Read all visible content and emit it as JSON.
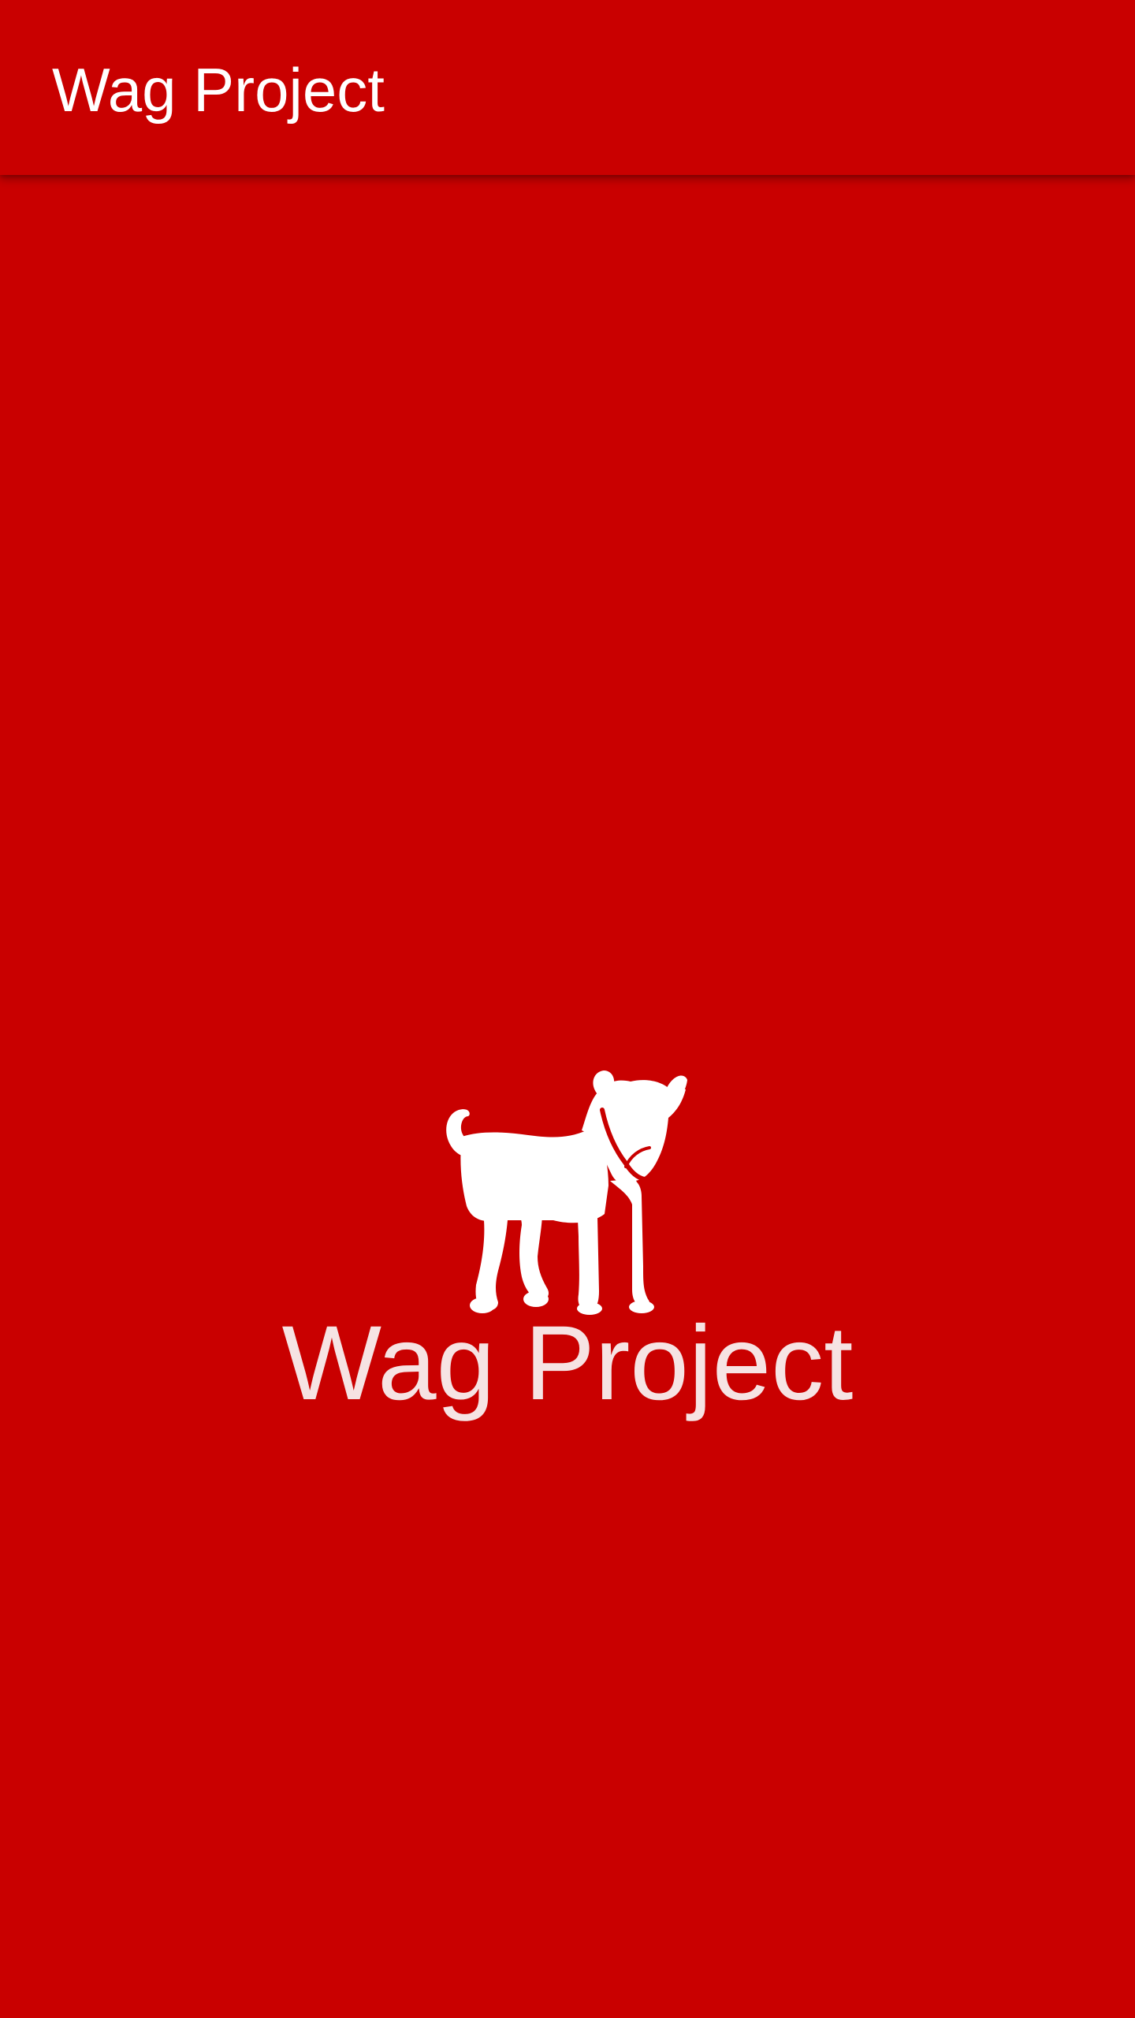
{
  "app_bar": {
    "title": "Wag Project"
  },
  "splash": {
    "icon": "dog-icon",
    "title": "Wag Project"
  },
  "colors": {
    "background": "#C90000",
    "app_bar": "#C90000",
    "title_text": "#FFFFFF",
    "splash_text": "#F6E3E3",
    "icon": "#FFFFFF"
  }
}
